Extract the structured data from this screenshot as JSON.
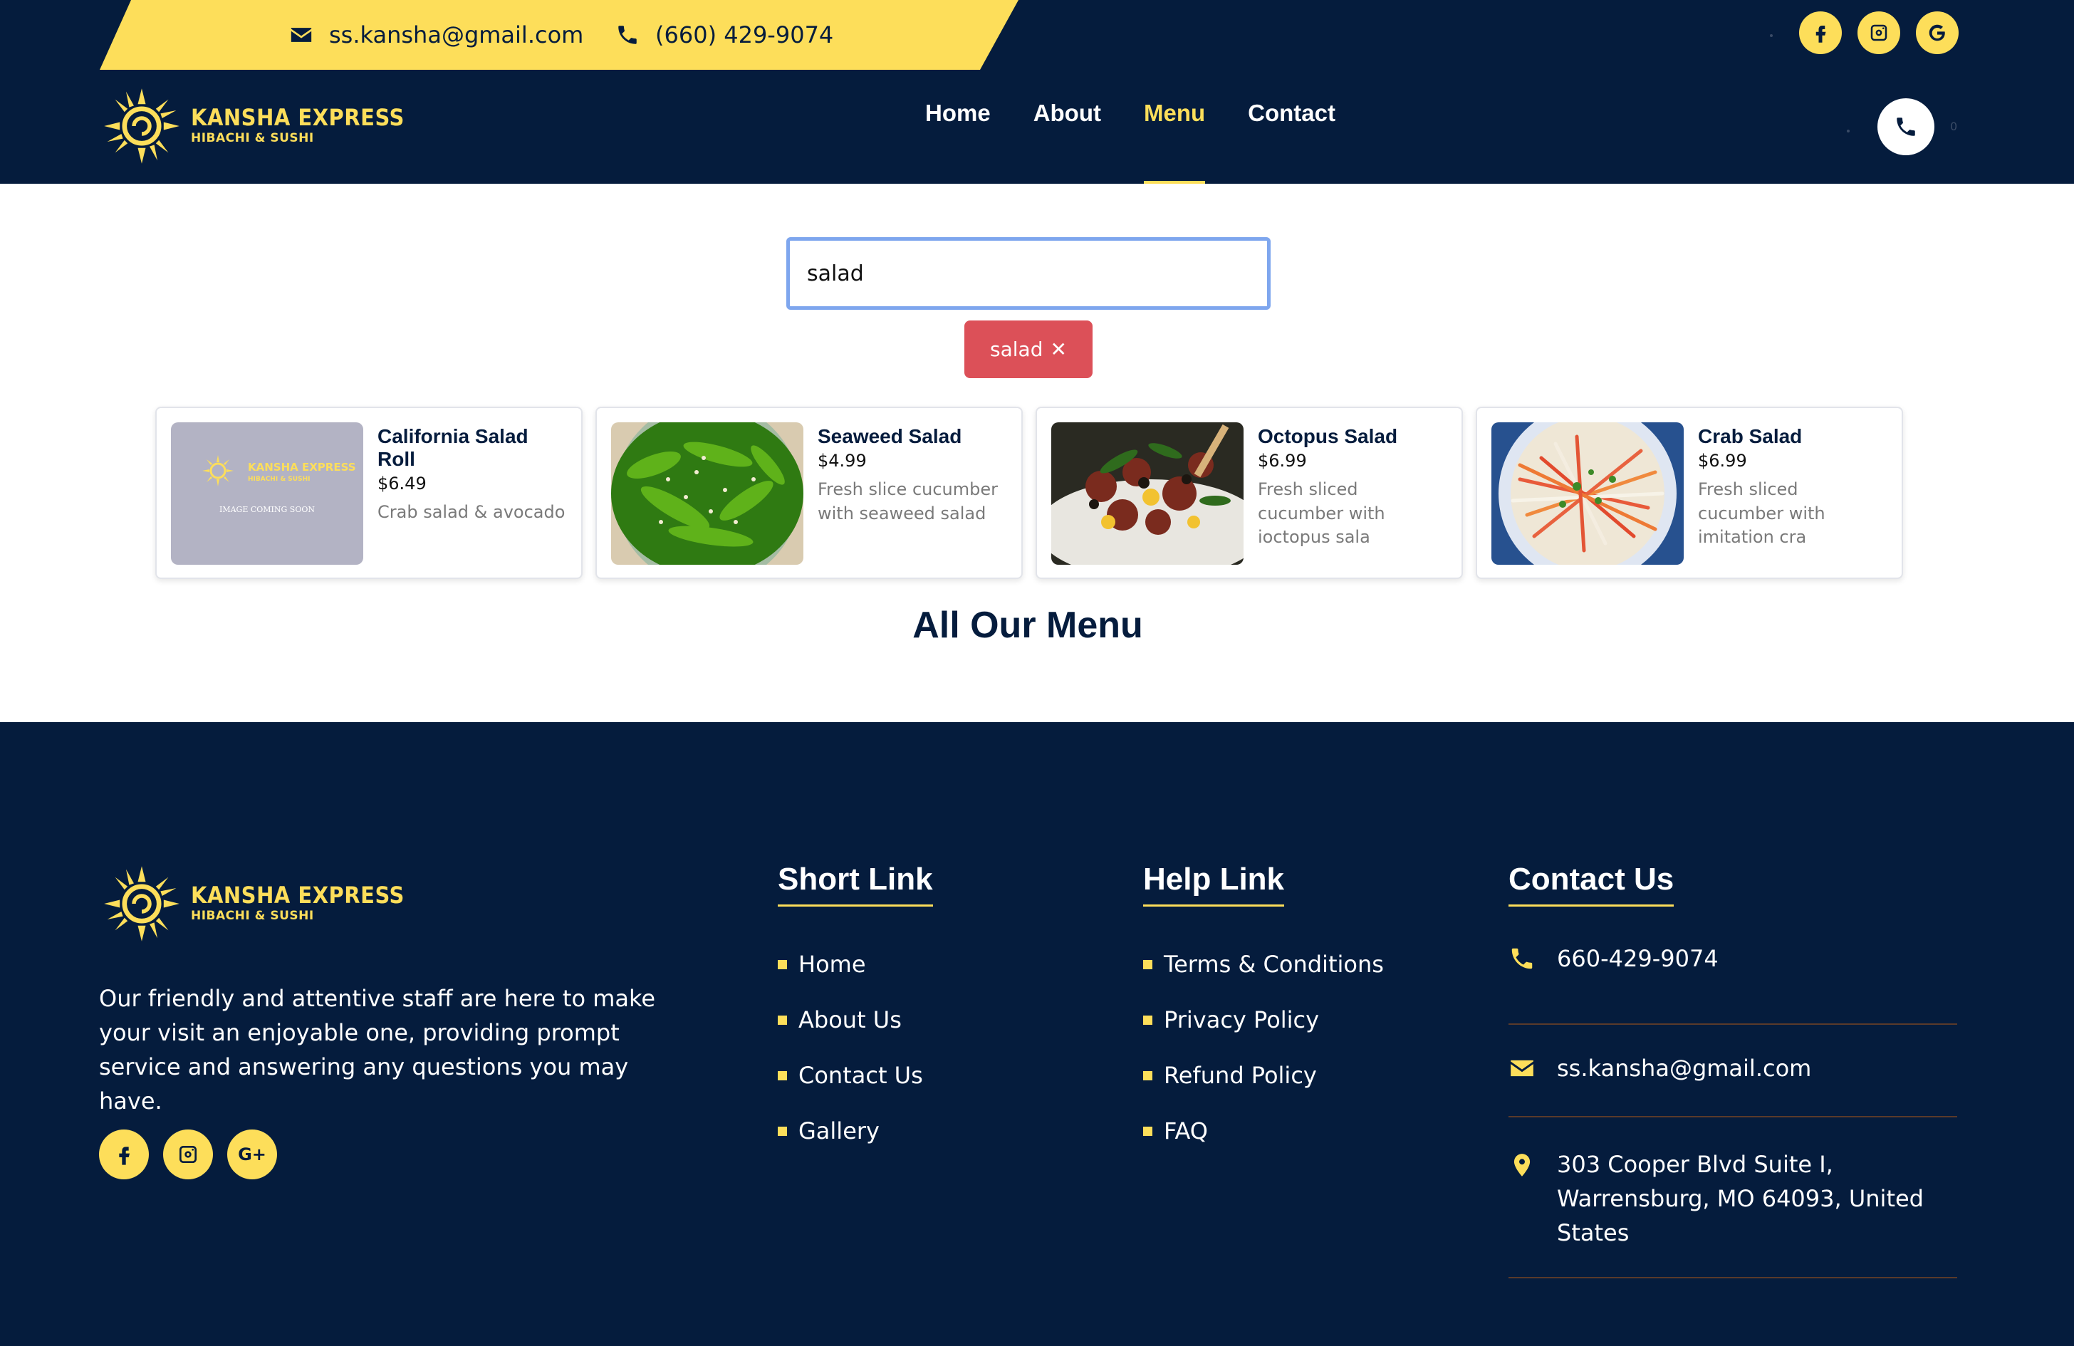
{
  "topbar": {
    "email": "ss.kansha@gmail.com",
    "phone": "(660) 429-9074"
  },
  "brand": {
    "name": "KANSHA EXPRESS",
    "subtitle": "HIBACHI & SUSHI"
  },
  "nav": {
    "items": [
      {
        "label": "Home",
        "active": false
      },
      {
        "label": "About",
        "active": false
      },
      {
        "label": "Menu",
        "active": true
      },
      {
        "label": "Contact",
        "active": false
      }
    ],
    "cart_count": "0"
  },
  "social": [
    "facebook-icon",
    "instagram-icon",
    "google-icon"
  ],
  "search": {
    "value": "salad",
    "tag": "salad",
    "tag_close": "✕"
  },
  "menu_items": [
    {
      "title": "California Salad Roll",
      "price": "$6.49",
      "desc": "Crab salad & avocado",
      "image": "placeholder",
      "image_text": "IMAGE COMING SOON"
    },
    {
      "title": "Seaweed Salad",
      "price": "$4.99",
      "desc": "Fresh slice cucumber with seaweed salad",
      "image": "seaweed"
    },
    {
      "title": "Octopus Salad",
      "price": "$6.99",
      "desc": "Fresh sliced cucumber with ioctopus sala",
      "image": "octopus"
    },
    {
      "title": "Crab Salad",
      "price": "$6.99",
      "desc": "Fresh sliced cucumber with imitation cra",
      "image": "crab"
    }
  ],
  "section_title": "All Our Menu",
  "footer": {
    "about": "Our friendly and attentive staff are here to make your visit an enjoyable one, providing prompt service and answering any questions you may have.",
    "short_link": {
      "heading": "Short Link",
      "items": [
        "Home",
        "About Us",
        "Contact Us",
        "Gallery"
      ]
    },
    "help_link": {
      "heading": "Help Link",
      "items": [
        "Terms & Conditions",
        "Privacy Policy",
        "Refund Policy",
        "FAQ"
      ]
    },
    "contact": {
      "heading": "Contact Us",
      "phone": "660-429-9074",
      "email": "ss.kansha@gmail.com",
      "address": "303 Cooper Blvd Suite I, Warrensburg, MO 64093, United States"
    }
  },
  "colors": {
    "navy": "#051c3d",
    "yellow": "#fdde5a",
    "tag_red": "#dc5058",
    "search_border": "#7ea6ee"
  }
}
